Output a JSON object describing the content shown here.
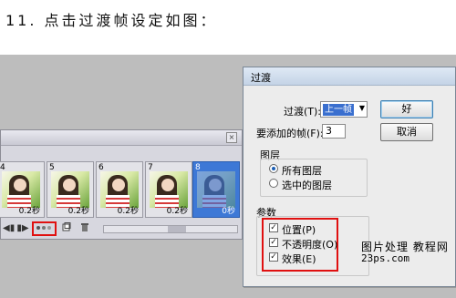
{
  "step_title": "11. 点击过渡帧设定如图：",
  "animation_panel": {
    "close_glyph": "×",
    "frames": [
      {
        "number": "4",
        "time": "0.2秒",
        "selected": false
      },
      {
        "number": "5",
        "time": "0.2秒",
        "selected": false
      },
      {
        "number": "6",
        "time": "0.2秒",
        "selected": false
      },
      {
        "number": "7",
        "time": "0.2秒",
        "selected": false
      },
      {
        "number": "8",
        "time": "0秒",
        "selected": true
      }
    ],
    "toolbar": {
      "step_back_glyph": "◀▮",
      "play_glyph": "▶",
      "step_forward_glyph": "▮▶",
      "tween_icon": "tween-icon",
      "duplicate_icon": "duplicate-frame-icon",
      "delete_icon": "trash-icon"
    }
  },
  "tween_dialog": {
    "title": "过渡",
    "tween_with_label": "过渡(T):",
    "tween_with_value": "上一帧",
    "frames_to_add_label": "要添加的帧(F):",
    "frames_to_add_value": "3",
    "ok_label": "好",
    "cancel_label": "取消",
    "layers_group_label": "图层",
    "all_layers_label": "所有图层",
    "selected_layers_label": "选中的图层",
    "params_group_label": "参数",
    "position_label": "位置(P)",
    "opacity_label": "不透明度(O)",
    "effects_label": "效果(E)",
    "check_glyph": "✓"
  },
  "watermark": {
    "line1": "图片处理 教程网",
    "line2": "23ps.com"
  },
  "colors": {
    "highlight_red": "#e01010",
    "selected_frame_blue": "#3d78d6",
    "background_gray": "#bdbdbd"
  }
}
